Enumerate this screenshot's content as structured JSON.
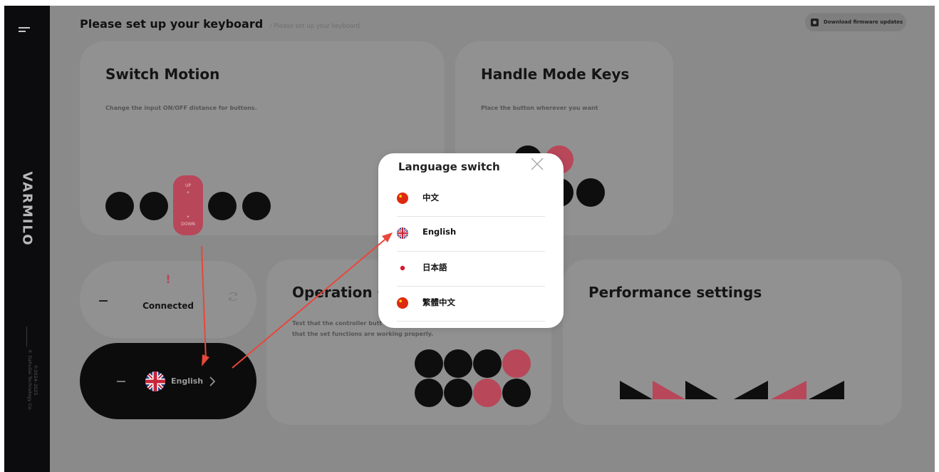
{
  "sidebar": {
    "brand": "VARMILO",
    "copyright": [
      "©2024–2025",
      "© Dahuilai Technology Co."
    ]
  },
  "header": {
    "title": "Please set up your keyboard",
    "subtitle": "/ Please set up your keyboard",
    "firmware_button": "Download firmware updates"
  },
  "cards": {
    "switch_motion": {
      "title": "Switch Motion",
      "desc": "Change the input ON/OFF distance for buttons.",
      "up_label": "UP",
      "down_label": "DOWN"
    },
    "handle_mode": {
      "title": "Handle Mode Keys",
      "desc": "Place the button wherever you want"
    },
    "status": {
      "warning": "!",
      "label": "Connected"
    },
    "language": {
      "current": "English"
    },
    "operation": {
      "title": "Operation C",
      "desc_line1": "Test that the controller butt",
      "desc_line2": "that the set functions are working properly."
    },
    "performance": {
      "title": "Performance settings"
    }
  },
  "modal": {
    "title": "Language switch",
    "options": [
      {
        "label": "中文",
        "icon": "china-flag-icon"
      },
      {
        "label": "English",
        "icon": "uk-flag-icon"
      },
      {
        "label": "日本語",
        "icon": "japan-flag-icon"
      },
      {
        "label": "繁體中文",
        "icon": "china-flag-icon"
      }
    ]
  },
  "colors": {
    "accent": "#b8475a",
    "overlay": "#8a8a8a",
    "sidebar": "#0c0c0e",
    "annotation_arrow": "#e8473a"
  }
}
